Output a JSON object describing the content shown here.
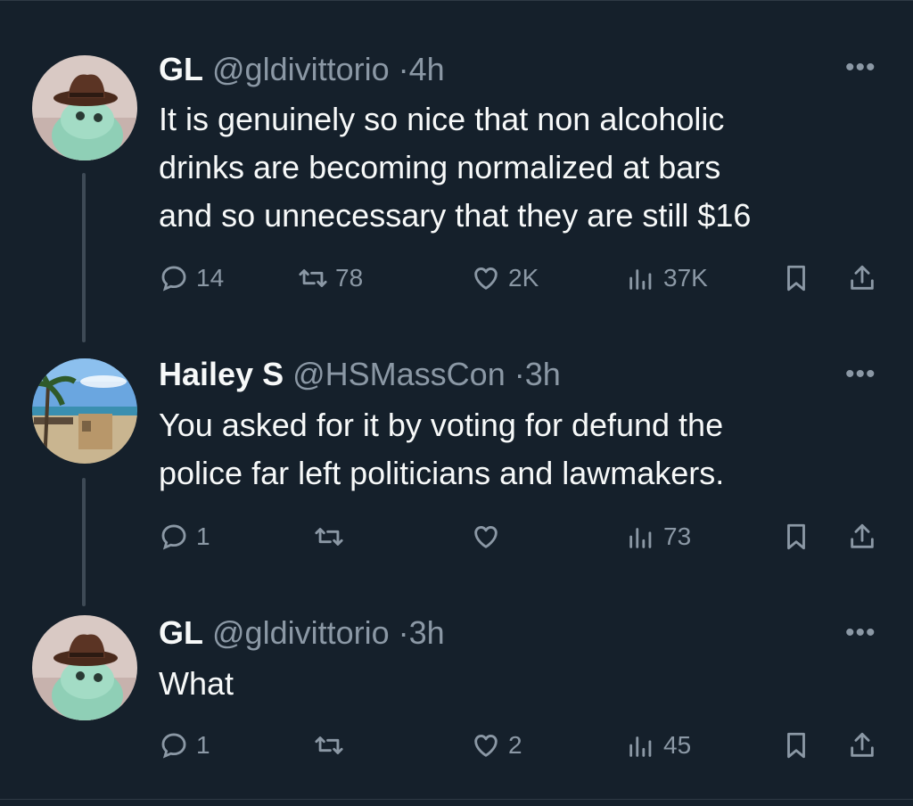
{
  "tweets": [
    {
      "name": "GL",
      "handle": "@gldivittorio",
      "separator": "·",
      "time": "4h",
      "more": "•••",
      "text_lines": [
        "It is genuinely so nice that non alcoholic",
        "drinks are becoming normalized at bars",
        "and so unnecessary that they are still $16"
      ],
      "replies": "14",
      "retweets": "78",
      "likes": "2K",
      "views": "37K"
    },
    {
      "name": "Hailey S",
      "handle": "@HSMassCon",
      "separator": "·",
      "time": "3h",
      "more": "•••",
      "text_lines": [
        "You asked for it by voting for defund the",
        "police far left politicians and lawmakers."
      ],
      "replies": "1",
      "retweets": "",
      "likes": "",
      "views": "73"
    },
    {
      "name": "GL",
      "handle": "@gldivittorio",
      "separator": "·",
      "time": "3h",
      "more": "•••",
      "text_lines": [
        "What"
      ],
      "replies": "1",
      "retweets": "",
      "likes": "2",
      "views": "45"
    }
  ],
  "icons": {
    "reply": "reply-icon",
    "retweet": "retweet-icon",
    "like": "heart-icon",
    "views": "views-icon",
    "bookmark": "bookmark-icon",
    "share": "share-icon"
  },
  "colors": {
    "background": "#15202b",
    "text": "#f7f9f9",
    "muted": "#8b98a5",
    "thread_line": "#3e4a56"
  }
}
